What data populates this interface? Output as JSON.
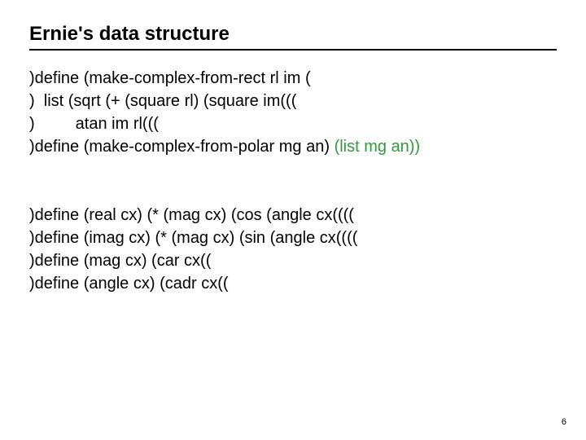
{
  "title": "Ernie's data structure",
  "block1": {
    "l1": ")define (make-complex-from-rect rl im (",
    "l2": ")  list (sqrt (+ (square rl) (square im(((",
    "l3": ")         atan im rl(((",
    "l4a": ")define (make-complex-from-polar mg an) ",
    "l4b": "(list mg an))"
  },
  "block2": {
    "l1": ")define (real cx) (* (mag cx) (cos (angle cx((((",
    "l2": ")define (imag cx) (* (mag cx) (sin (angle cx((((",
    "l3": ")define (mag cx) (car cx((",
    "l4": ")define (angle cx) (cadr cx(("
  },
  "page": "6"
}
